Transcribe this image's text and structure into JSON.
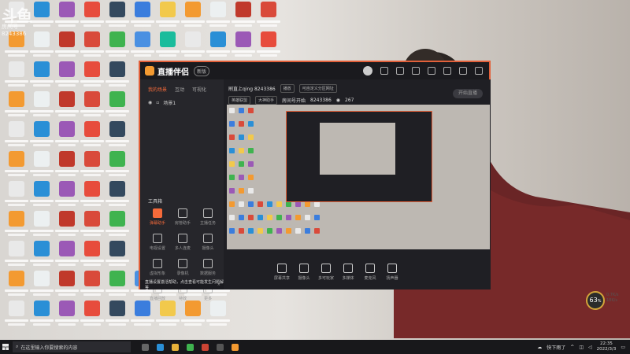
{
  "overlay": {
    "brand": "斗鱼",
    "sub": "房间号",
    "room": "8243386"
  },
  "app": {
    "logo_text": "直播伴侣",
    "badge": "新版",
    "tabs": [
      "我的场景",
      "互动",
      "可视化"
    ],
    "scene": "场景1",
    "tools_title": "工具箱",
    "tools": [
      {
        "label": "弹幕助手",
        "hot": true
      },
      {
        "label": "房管助手",
        "hot": false
      },
      {
        "label": "主播任务",
        "hot": false
      },
      {
        "label": "电视设置",
        "hot": false
      },
      {
        "label": "多人连麦",
        "hot": false
      },
      {
        "label": "摄像头",
        "hot": false
      },
      {
        "label": "虚拟形象",
        "hot": false
      },
      {
        "label": "录像机",
        "hot": false
      },
      {
        "label": "数据服务",
        "hot": false
      },
      {
        "label": "直播回放",
        "hot": false
      },
      {
        "label": "特效",
        "hot": false
      },
      {
        "label": "更多",
        "hot": false
      }
    ],
    "notice": "直播设置激活帮助，点击查看可能发生问题解答",
    "room_title": "刷直上qing 8243386",
    "room_tag": "播放",
    "room_link": "可自定义分区网址",
    "room_cat": "英雄联盟",
    "room_sub": "大神助手",
    "room_id_label": "房间号开始",
    "room_id": "8243386",
    "viewers": "267",
    "controls": [
      "屏幕共享",
      "摄像头",
      "多可玩家",
      "多媒体",
      "麦克风",
      "扬声器"
    ],
    "go_live": "开始直播"
  },
  "taskbar": {
    "search_placeholder": "在这里输入你要搜索的内容",
    "weather": "快下雨了",
    "time": "22:35",
    "date": "2022/3/3"
  },
  "perf": {
    "value": "63",
    "unit": "%",
    "up": "0.7K/s",
    "down": "18K/s"
  },
  "colors": {
    "accent": "#f56a3a",
    "border": "#e2603a",
    "app_bg": "#1f1f24"
  }
}
